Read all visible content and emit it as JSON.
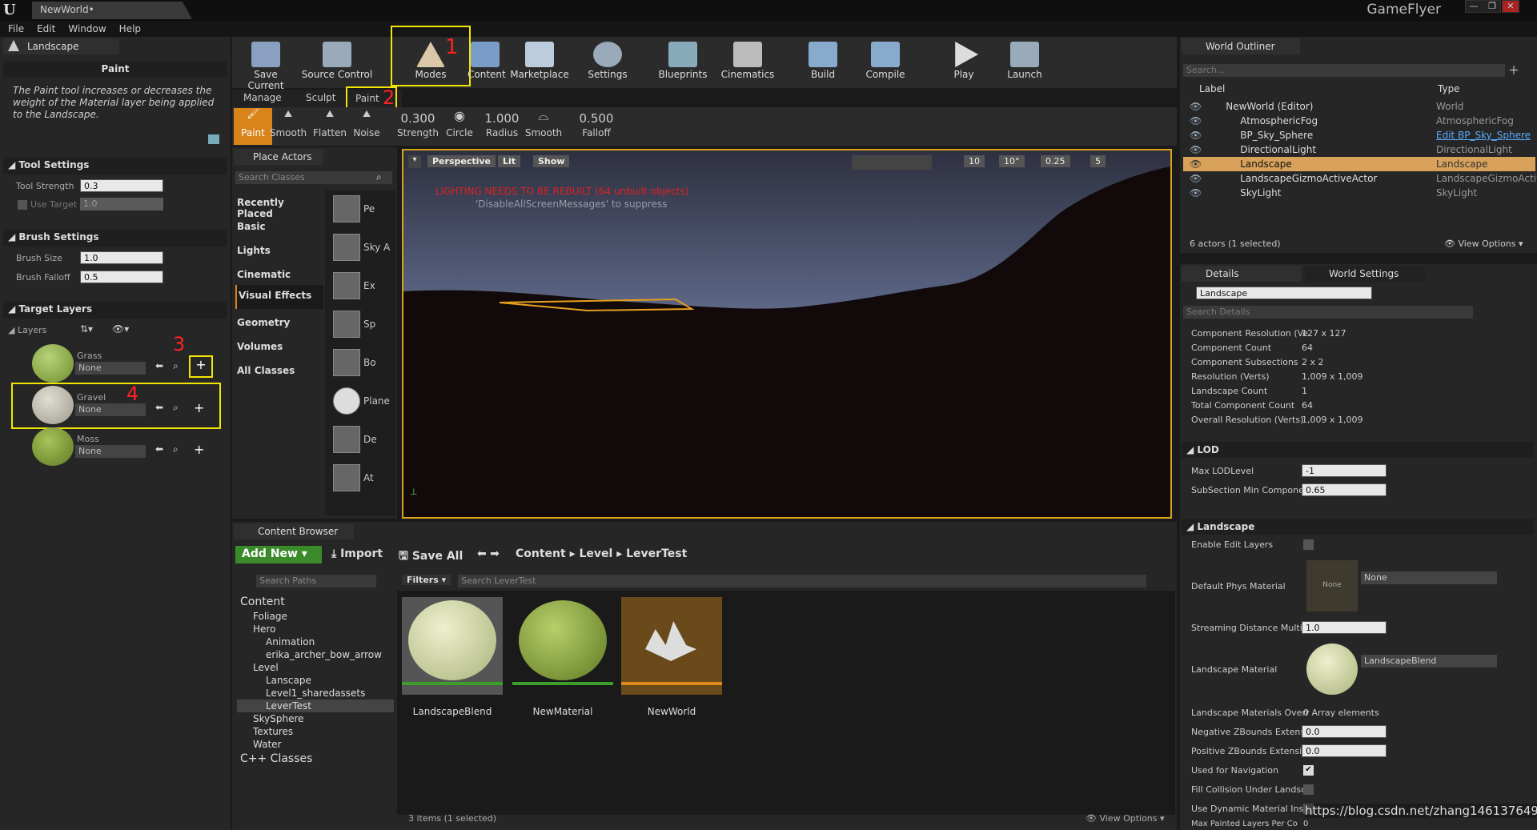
{
  "window": {
    "doc_tab": "NewWorld•",
    "brand": "GameFlyer",
    "controls": [
      "—",
      "❐",
      "✕"
    ]
  },
  "menu": [
    "File",
    "Edit",
    "Window",
    "Help"
  ],
  "left": {
    "tab": "Landscape",
    "mode_title": "Paint",
    "description": "The Paint tool increases or decreases the weight of the Material layer being applied to the Landscape.",
    "tool_settings": {
      "header": "Tool Settings",
      "strength_label": "Tool Strength",
      "strength_value": "0.3",
      "use_target_label": "Use Target",
      "use_target_value": "1.0"
    },
    "brush_settings": {
      "header": "Brush Settings",
      "size_label": "Brush Size",
      "size_value": "1.0",
      "falloff_label": "Brush Falloff",
      "falloff_value": "0.5"
    },
    "target_layers": {
      "header": "Target Layers",
      "layers_label": "Layers",
      "layers": [
        {
          "name": "Grass",
          "value": "None"
        },
        {
          "name": "Gravel",
          "value": "None"
        },
        {
          "name": "Moss",
          "value": "None"
        }
      ]
    }
  },
  "toolbar": [
    {
      "label": "Save Current",
      "color": "#8aa0c0"
    },
    {
      "label": "Source Control",
      "color": "#9ab"
    },
    {
      "label": "Modes",
      "color": "#d9c7a8"
    },
    {
      "label": "Content",
      "color": "#7a9cc8"
    },
    {
      "label": "Marketplace",
      "color": "#bcd"
    },
    {
      "label": "Settings",
      "color": "#9ab"
    },
    {
      "label": "Blueprints",
      "color": "#8ab"
    },
    {
      "label": "Cinematics",
      "color": "#bbb"
    },
    {
      "label": "Build",
      "color": "#8ac"
    },
    {
      "label": "Compile",
      "color": "#8ac"
    },
    {
      "label": "Play",
      "color": "#ddd"
    },
    {
      "label": "Launch",
      "color": "#9ab"
    }
  ],
  "annotations": [
    "1",
    "2",
    "3",
    "4"
  ],
  "modes": {
    "tabs": [
      "Manage",
      "Sculpt",
      "Paint"
    ],
    "tools": [
      "Paint",
      "Smooth",
      "Flatten",
      "Noise"
    ],
    "params": [
      {
        "value": "0.300",
        "label": "Strength"
      },
      {
        "value": "",
        "label": "Circle"
      },
      {
        "value": "1.000",
        "label": "Radius"
      },
      {
        "value": "",
        "label": "Smooth"
      },
      {
        "value": "0.500",
        "label": "Falloff"
      }
    ]
  },
  "place_actors": {
    "title": "Place Actors",
    "search_placeholder": "Search Classes",
    "categories": [
      "Recently Placed",
      "Basic",
      "Lights",
      "Cinematic",
      "Visual Effects",
      "Geometry",
      "Volumes",
      "All Classes"
    ],
    "actors": [
      "Pe",
      "Sky A",
      "Ex",
      "Sp",
      "Bo",
      "Plane",
      "De",
      "At"
    ]
  },
  "viewport": {
    "buttons": [
      "Perspective",
      "Lit",
      "Show"
    ],
    "warning": "LIGHTING NEEDS TO BE REBUILT (64 unbuilt objects)",
    "suppress": "'DisableAllScreenMessages' to suppress",
    "right_controls": [
      "10",
      "10°",
      "0.25",
      "5"
    ]
  },
  "content_browser": {
    "title": "Content Browser",
    "add_new": "Add New",
    "import": "Import",
    "save_all": "Save All",
    "breadcrumb": [
      "Content",
      "Level",
      "LeverTest"
    ],
    "search_paths": "Search Paths",
    "filters": "Filters",
    "search_assets": "Search LeverTest",
    "tree": [
      {
        "label": "Content",
        "depth": 0
      },
      {
        "label": "Foliage",
        "depth": 1
      },
      {
        "label": "Hero",
        "depth": 1
      },
      {
        "label": "Animation",
        "depth": 2
      },
      {
        "label": "erika_archer_bow_arrow",
        "depth": 2
      },
      {
        "label": "Level",
        "depth": 1
      },
      {
        "label": "Lanscape",
        "depth": 2
      },
      {
        "label": "Level1_sharedassets",
        "depth": 2
      },
      {
        "label": "LeverTest",
        "depth": 2
      },
      {
        "label": "SkySphere",
        "depth": 1
      },
      {
        "label": "Textures",
        "depth": 1
      },
      {
        "label": "Water",
        "depth": 1
      },
      {
        "label": "C++ Classes",
        "depth": 0
      }
    ],
    "assets": [
      "LandscapeBlend",
      "NewMaterial",
      "NewWorld"
    ],
    "status": "3 items (1 selected)",
    "view_options": "View Options"
  },
  "outliner": {
    "title": "World Outliner",
    "search": "Search...",
    "col_label": "Label",
    "col_type": "Type",
    "rows": [
      {
        "label": "NewWorld (Editor)",
        "type": "World"
      },
      {
        "label": "AtmosphericFog",
        "type": "AtmosphericFog"
      },
      {
        "label": "BP_Sky_Sphere",
        "type": "Edit BP_Sky_Sphere"
      },
      {
        "label": "DirectionalLight",
        "type": "DirectionalLight"
      },
      {
        "label": "Landscape",
        "type": "Landscape"
      },
      {
        "label": "LandscapeGizmoActiveActor",
        "type": "LandscapeGizmoActiv"
      },
      {
        "label": "SkyLight",
        "type": "SkyLight"
      }
    ],
    "status": "6 actors (1 selected)",
    "view_options": "View Options"
  },
  "details": {
    "tab1": "Details",
    "tab2": "World Settings",
    "name": "Landscape",
    "search": "Search Details",
    "info": [
      {
        "k": "Component Resolution (Ve",
        "v": "127 x 127"
      },
      {
        "k": "Component Count",
        "v": "64"
      },
      {
        "k": "Component Subsections",
        "v": "2 x 2"
      },
      {
        "k": "Resolution (Verts)",
        "v": "1,009 x 1,009"
      },
      {
        "k": "Landscape Count",
        "v": "1"
      },
      {
        "k": "Total Component Count",
        "v": "64"
      },
      {
        "k": "Overall Resolution (Verts)",
        "v": "1,009 x 1,009"
      }
    ],
    "lod_header": "LOD",
    "max_lod_label": "Max LODLevel",
    "max_lod": "-1",
    "subsection_label": "SubSection Min Componen",
    "subsection": "0.65",
    "landscape_header": "Landscape",
    "enable_edit_layers": "Enable Edit Layers",
    "phys_label": "Default Phys Material",
    "phys_value": "None",
    "phys_thumb": "None",
    "streaming_label": "Streaming Distance Multip",
    "streaming_value": "1.0",
    "material_label": "Landscape Material",
    "material_value": "LandscapeBlend",
    "overrides_label": "Landscape Materials Overr",
    "overrides_value": "0 Array elements",
    "neg_label": "Negative ZBounds Extensi",
    "neg_value": "0.0",
    "pos_label": "Positive ZBounds Extensio",
    "pos_value": "0.0",
    "nav_label": "Used for Navigation",
    "fill_label": "Fill Collision Under Landsc",
    "dyn_label": "Use Dynamic Material Inst",
    "max_painted_label": "Max Painted Layers Per Co",
    "max_painted_value": "0"
  },
  "watermark": "https://blog.csdn.net/zhang1461376499"
}
